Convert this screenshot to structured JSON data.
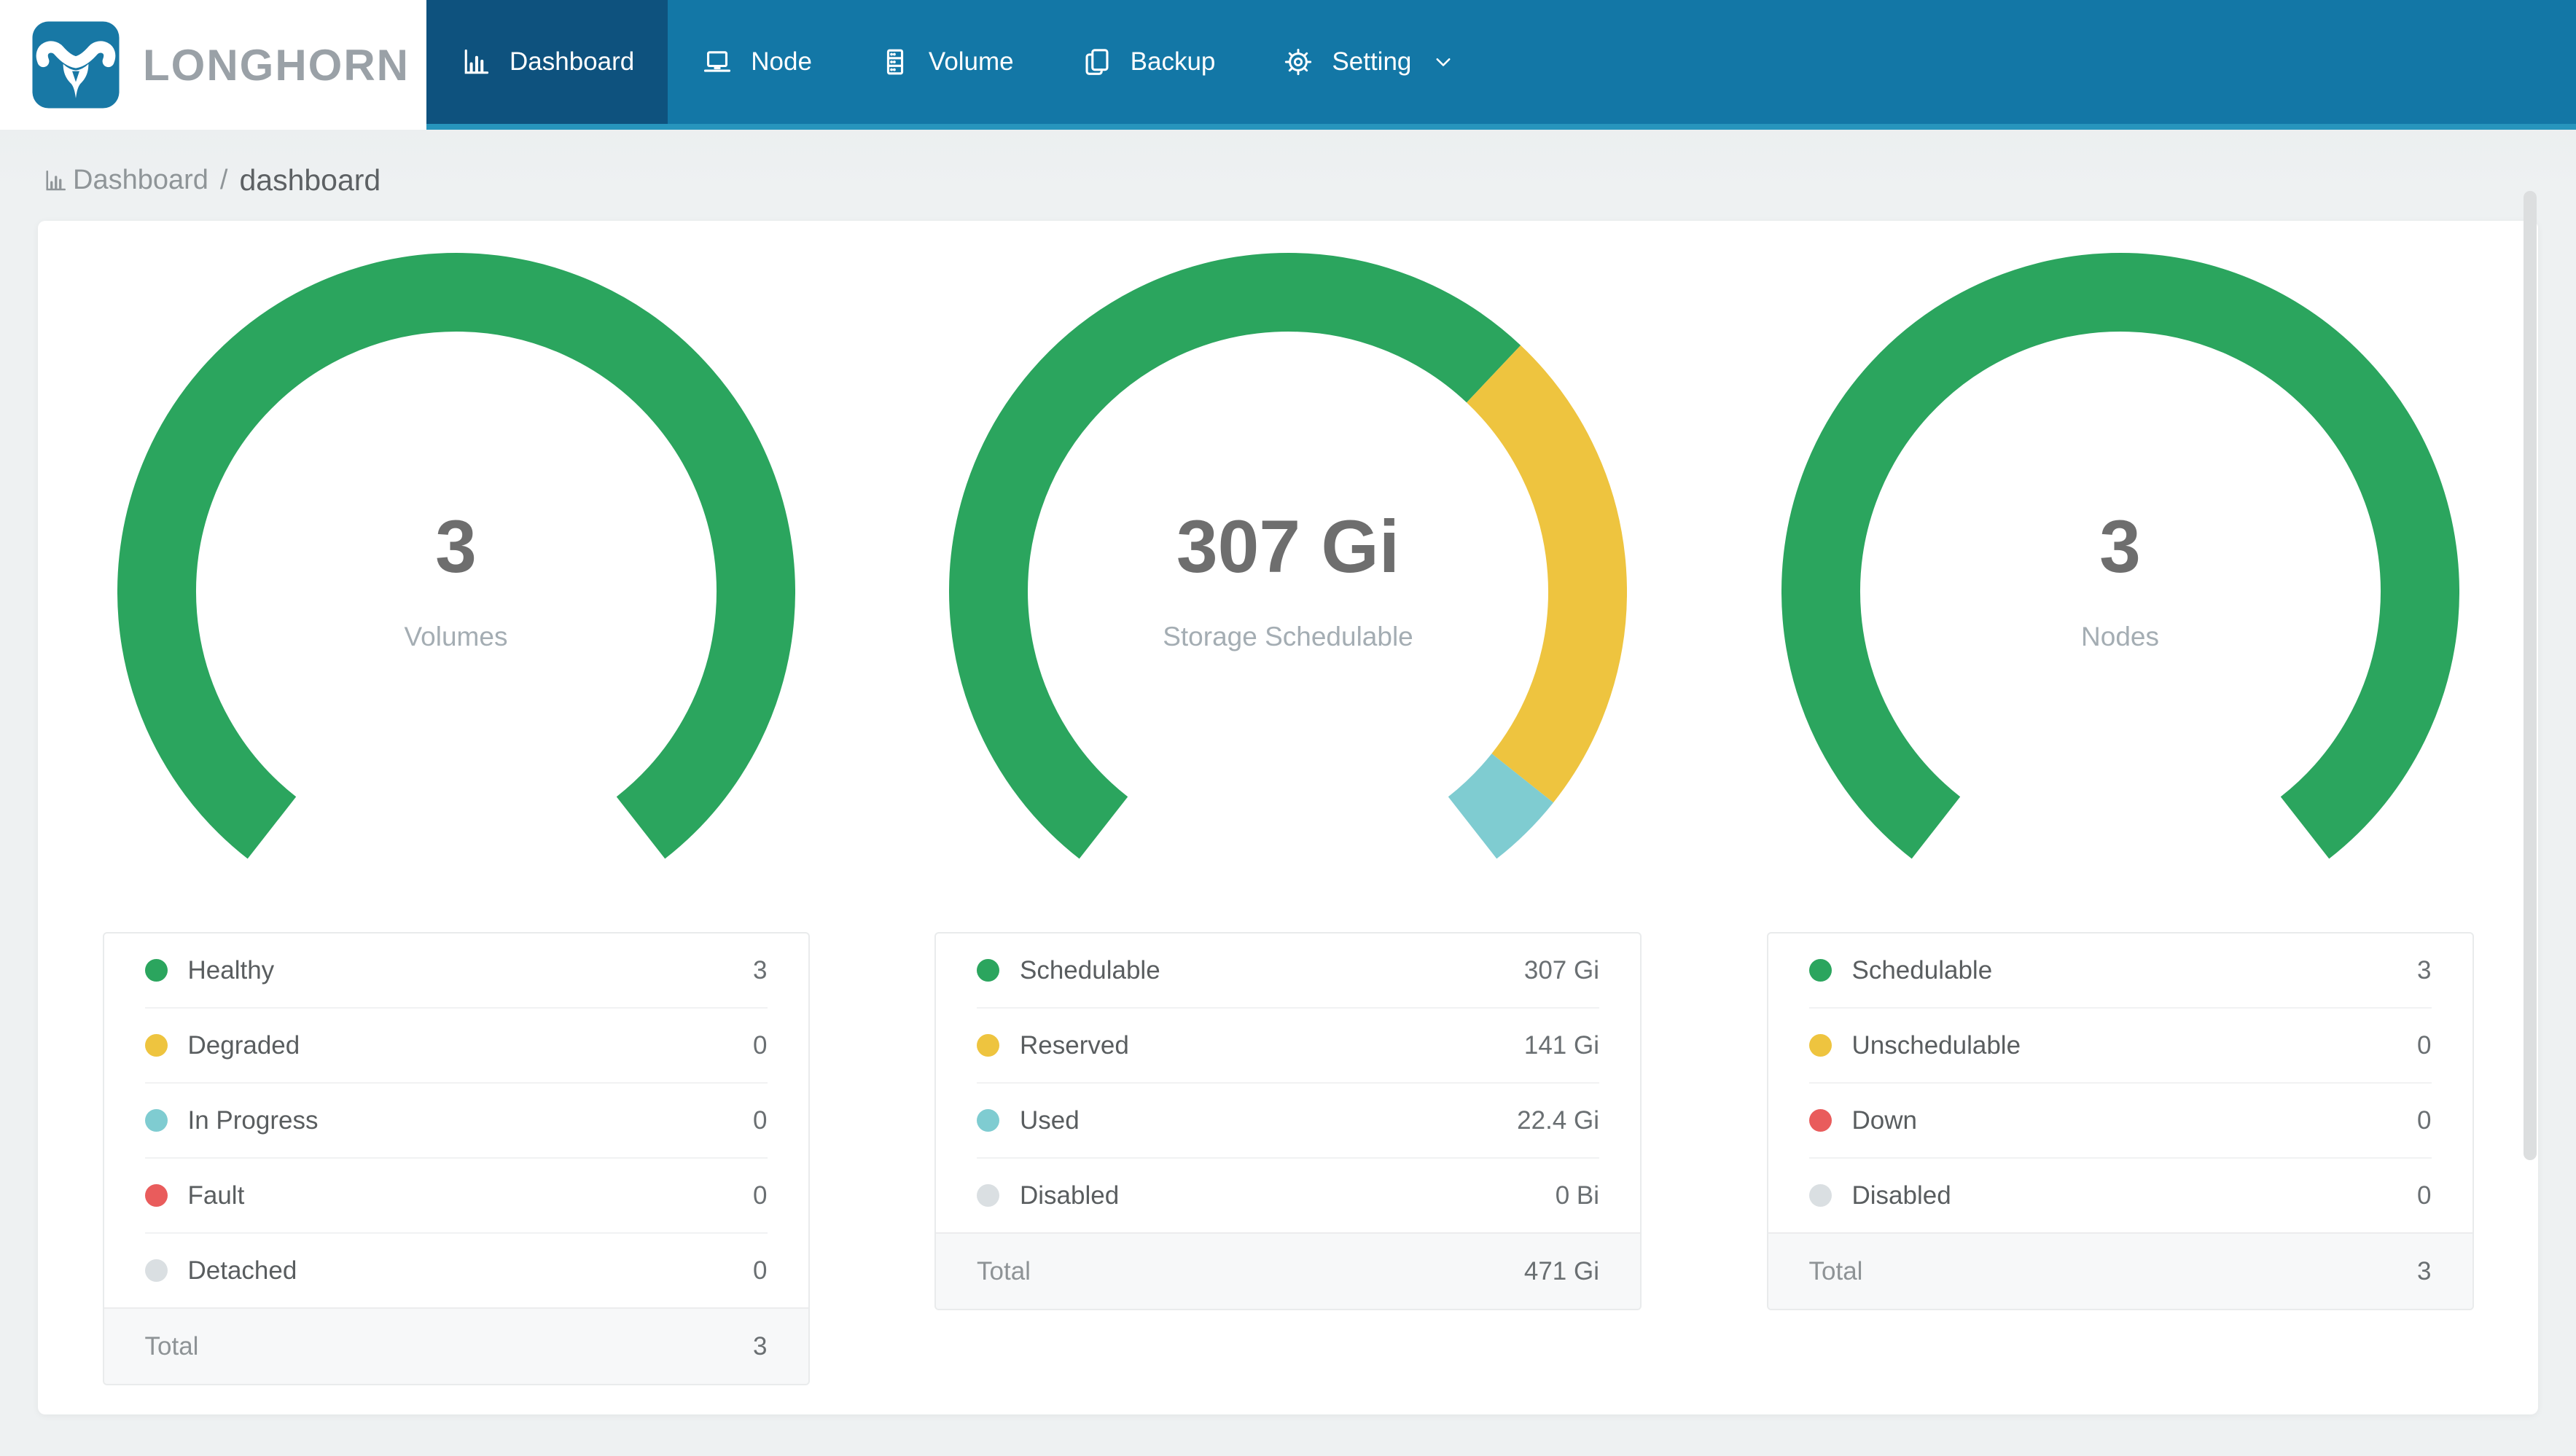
{
  "app": {
    "brand": "LONGHORN"
  },
  "nav": {
    "items": [
      {
        "label": "Dashboard",
        "icon": "bar-chart",
        "active": true,
        "dropdown": false
      },
      {
        "label": "Node",
        "icon": "laptop",
        "active": false,
        "dropdown": false
      },
      {
        "label": "Volume",
        "icon": "server",
        "active": false,
        "dropdown": false
      },
      {
        "label": "Backup",
        "icon": "copy",
        "active": false,
        "dropdown": false
      },
      {
        "label": "Setting",
        "icon": "gear",
        "active": false,
        "dropdown": true
      }
    ]
  },
  "breadcrumb": {
    "icon": "bar-chart",
    "section": "Dashboard",
    "separator": "/",
    "page": "dashboard"
  },
  "labels": {
    "total": "Total"
  },
  "colors": {
    "green": "#2BA55E",
    "yellow": "#EEC43F",
    "teal": "#7FCCD1",
    "red": "#E95C5C",
    "gray": "#DADFE2",
    "navbar": "#1377A6",
    "navbar_active": "#0E527E",
    "navbar_strip": "#2795BD",
    "brand_blue": "#1878A5"
  },
  "chart_data": [
    {
      "id": "volumes",
      "type": "donut-gauge",
      "center_value": "3",
      "center_label": "Volumes",
      "segments": [
        {
          "label": "Healthy",
          "color": "green",
          "value": 3,
          "display": "3"
        },
        {
          "label": "Degraded",
          "color": "yellow",
          "value": 0,
          "display": "0"
        },
        {
          "label": "In Progress",
          "color": "teal",
          "value": 0,
          "display": "0"
        },
        {
          "label": "Fault",
          "color": "red",
          "value": 0,
          "display": "0"
        },
        {
          "label": "Detached",
          "color": "gray",
          "value": 0,
          "display": "0"
        }
      ],
      "total_display": "3"
    },
    {
      "id": "storage",
      "type": "donut-gauge",
      "center_value": "307 Gi",
      "center_label": "Storage Schedulable",
      "segments": [
        {
          "label": "Schedulable",
          "color": "green",
          "value": 307,
          "display": "307 Gi"
        },
        {
          "label": "Reserved",
          "color": "yellow",
          "value": 141,
          "display": "141 Gi"
        },
        {
          "label": "Used",
          "color": "teal",
          "value": 22.4,
          "display": "22.4 Gi"
        },
        {
          "label": "Disabled",
          "color": "gray",
          "value": 0,
          "display": "0 Bi"
        }
      ],
      "total_display": "471 Gi"
    },
    {
      "id": "nodes",
      "type": "donut-gauge",
      "center_value": "3",
      "center_label": "Nodes",
      "segments": [
        {
          "label": "Schedulable",
          "color": "green",
          "value": 3,
          "display": "3"
        },
        {
          "label": "Unschedulable",
          "color": "yellow",
          "value": 0,
          "display": "0"
        },
        {
          "label": "Down",
          "color": "red",
          "value": 0,
          "display": "0"
        },
        {
          "label": "Disabled",
          "color": "gray",
          "value": 0,
          "display": "0"
        }
      ],
      "total_display": "3"
    }
  ],
  "gauge_geometry_note": {
    "start_angle_deg_from_top": -142,
    "sweep_deg": 284
  }
}
